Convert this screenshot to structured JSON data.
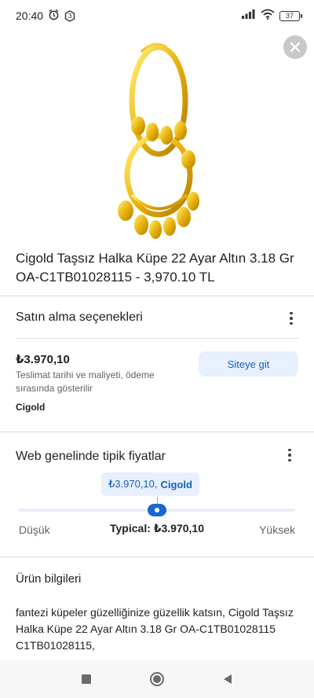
{
  "status_bar": {
    "time": "20:40",
    "notification_count": "3",
    "battery": "37"
  },
  "product": {
    "title": "Cigold Taşsız Halka Küpe 22 Ayar Altın 3.18 Gr OA-C1TB01028115 - 3,970.10 TL",
    "image_icon": "gold-hoop-earring-image"
  },
  "purchase_options": {
    "heading": "Satın alma seçenekleri",
    "price": "₺3.970,10",
    "delivery_note": "Teslimat tarihi ve maliyeti, ödeme sırasında gösterilir",
    "seller": "Cigold",
    "visit_button": "Siteye git"
  },
  "typical_prices": {
    "heading": "Web genelinde tipik fiyatlar",
    "tooltip_price": "₺3.970,10,",
    "tooltip_seller": "Cigold",
    "low_label": "Düşük",
    "high_label": "Yüksek",
    "typical_label": "Typical: ₺3.970,10",
    "slider_position_fraction": 0.5
  },
  "product_info": {
    "heading": "Ürün bilgileri",
    "description": "fantezi küpeler güzelliğinize güzellik katsın, Cigold Taşsız Halka Küpe 22 Ayar Altın 3.18 Gr OA-C1TB01028115 C1TB01028115,"
  },
  "colors": {
    "accent_blue": "#1967d2",
    "chip_background": "#e8f0fe",
    "gold": "#e9b20c"
  }
}
